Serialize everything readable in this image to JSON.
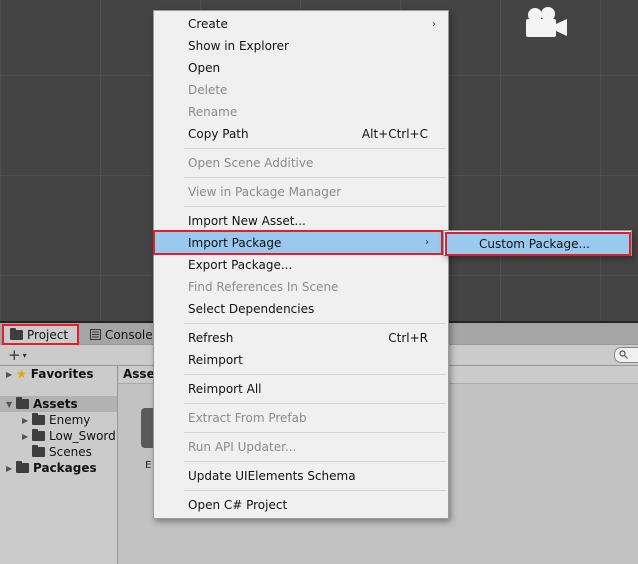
{
  "tabs": {
    "project": "Project",
    "console": "Console"
  },
  "toolbar": {
    "add": "+",
    "add_arrow": "▾",
    "search_icon": "search-icon"
  },
  "tree": {
    "favorites": "Favorites",
    "assets": "Assets",
    "enemy": "Enemy",
    "low_sword": "Low_Sword",
    "scenes": "Scenes",
    "packages": "Packages"
  },
  "content": {
    "breadcrumb": "Asset",
    "asset_label": "E"
  },
  "context_menu": {
    "create": "Create",
    "show_in_explorer": "Show in Explorer",
    "open": "Open",
    "delete": "Delete",
    "rename": "Rename",
    "copy_path": "Copy Path",
    "copy_path_shortcut": "Alt+Ctrl+C",
    "open_scene_additive": "Open Scene Additive",
    "view_in_package_manager": "View in Package Manager",
    "import_new_asset": "Import New Asset...",
    "import_package": "Import Package",
    "export_package": "Export Package...",
    "find_references": "Find References In Scene",
    "select_dependencies": "Select Dependencies",
    "refresh": "Refresh",
    "refresh_shortcut": "Ctrl+R",
    "reimport": "Reimport",
    "reimport_all": "Reimport All",
    "extract_from_prefab": "Extract From Prefab",
    "run_api_updater": "Run API Updater...",
    "update_uielements_schema": "Update UIElements Schema",
    "open_csharp_project": "Open C# Project",
    "submenu_arrow": "›"
  },
  "submenu": {
    "custom_package": "Custom Package..."
  },
  "colors": {
    "highlight": "#99c9ef",
    "annotation_border": "#e0202a",
    "scene_bg": "#444444"
  }
}
